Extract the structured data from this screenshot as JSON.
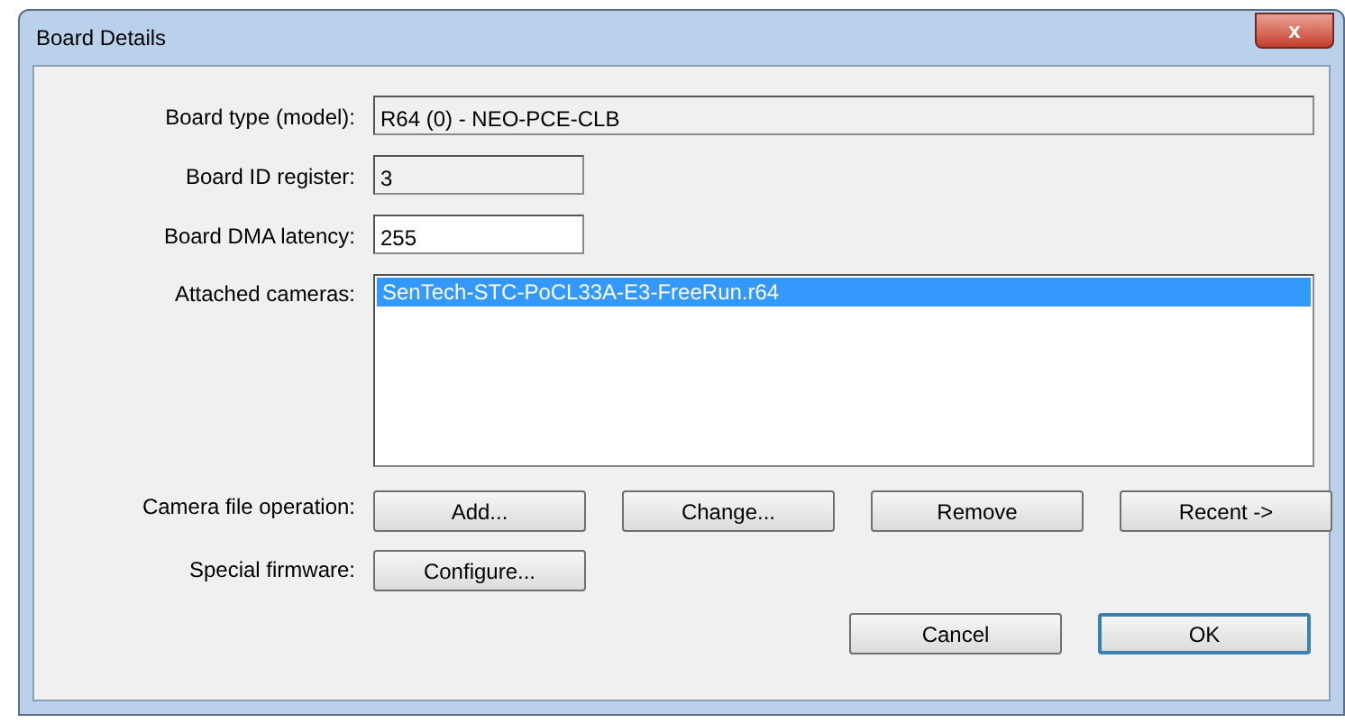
{
  "window": {
    "title": "Board Details",
    "close": "x"
  },
  "fields": [
    {
      "label": "Board type (model):",
      "value": "R64 (0) - NEO-PCE-CLB",
      "kind": "readonly",
      "wide": true
    },
    {
      "label": "Board ID register:",
      "value": "3",
      "kind": "readonly",
      "wide": false
    },
    {
      "label": "Board DMA latency:",
      "value": "255",
      "kind": "editable",
      "wide": false
    }
  ],
  "cameras": {
    "label": "Attached cameras:",
    "items": [
      {
        "text": "SenTech-STC-PoCL33A-E3-FreeRun.r64",
        "selected": true
      }
    ]
  },
  "camera_file_operation": {
    "label": "Camera file operation:",
    "buttons": [
      "Add...",
      "Change...",
      "Remove",
      "Recent ->"
    ]
  },
  "special_firmware": {
    "label": "Special firmware:",
    "button": "Configure..."
  },
  "buttons": [
    {
      "label": "Cancel",
      "default": false
    },
    {
      "label": "OK",
      "default": true
    }
  ]
}
